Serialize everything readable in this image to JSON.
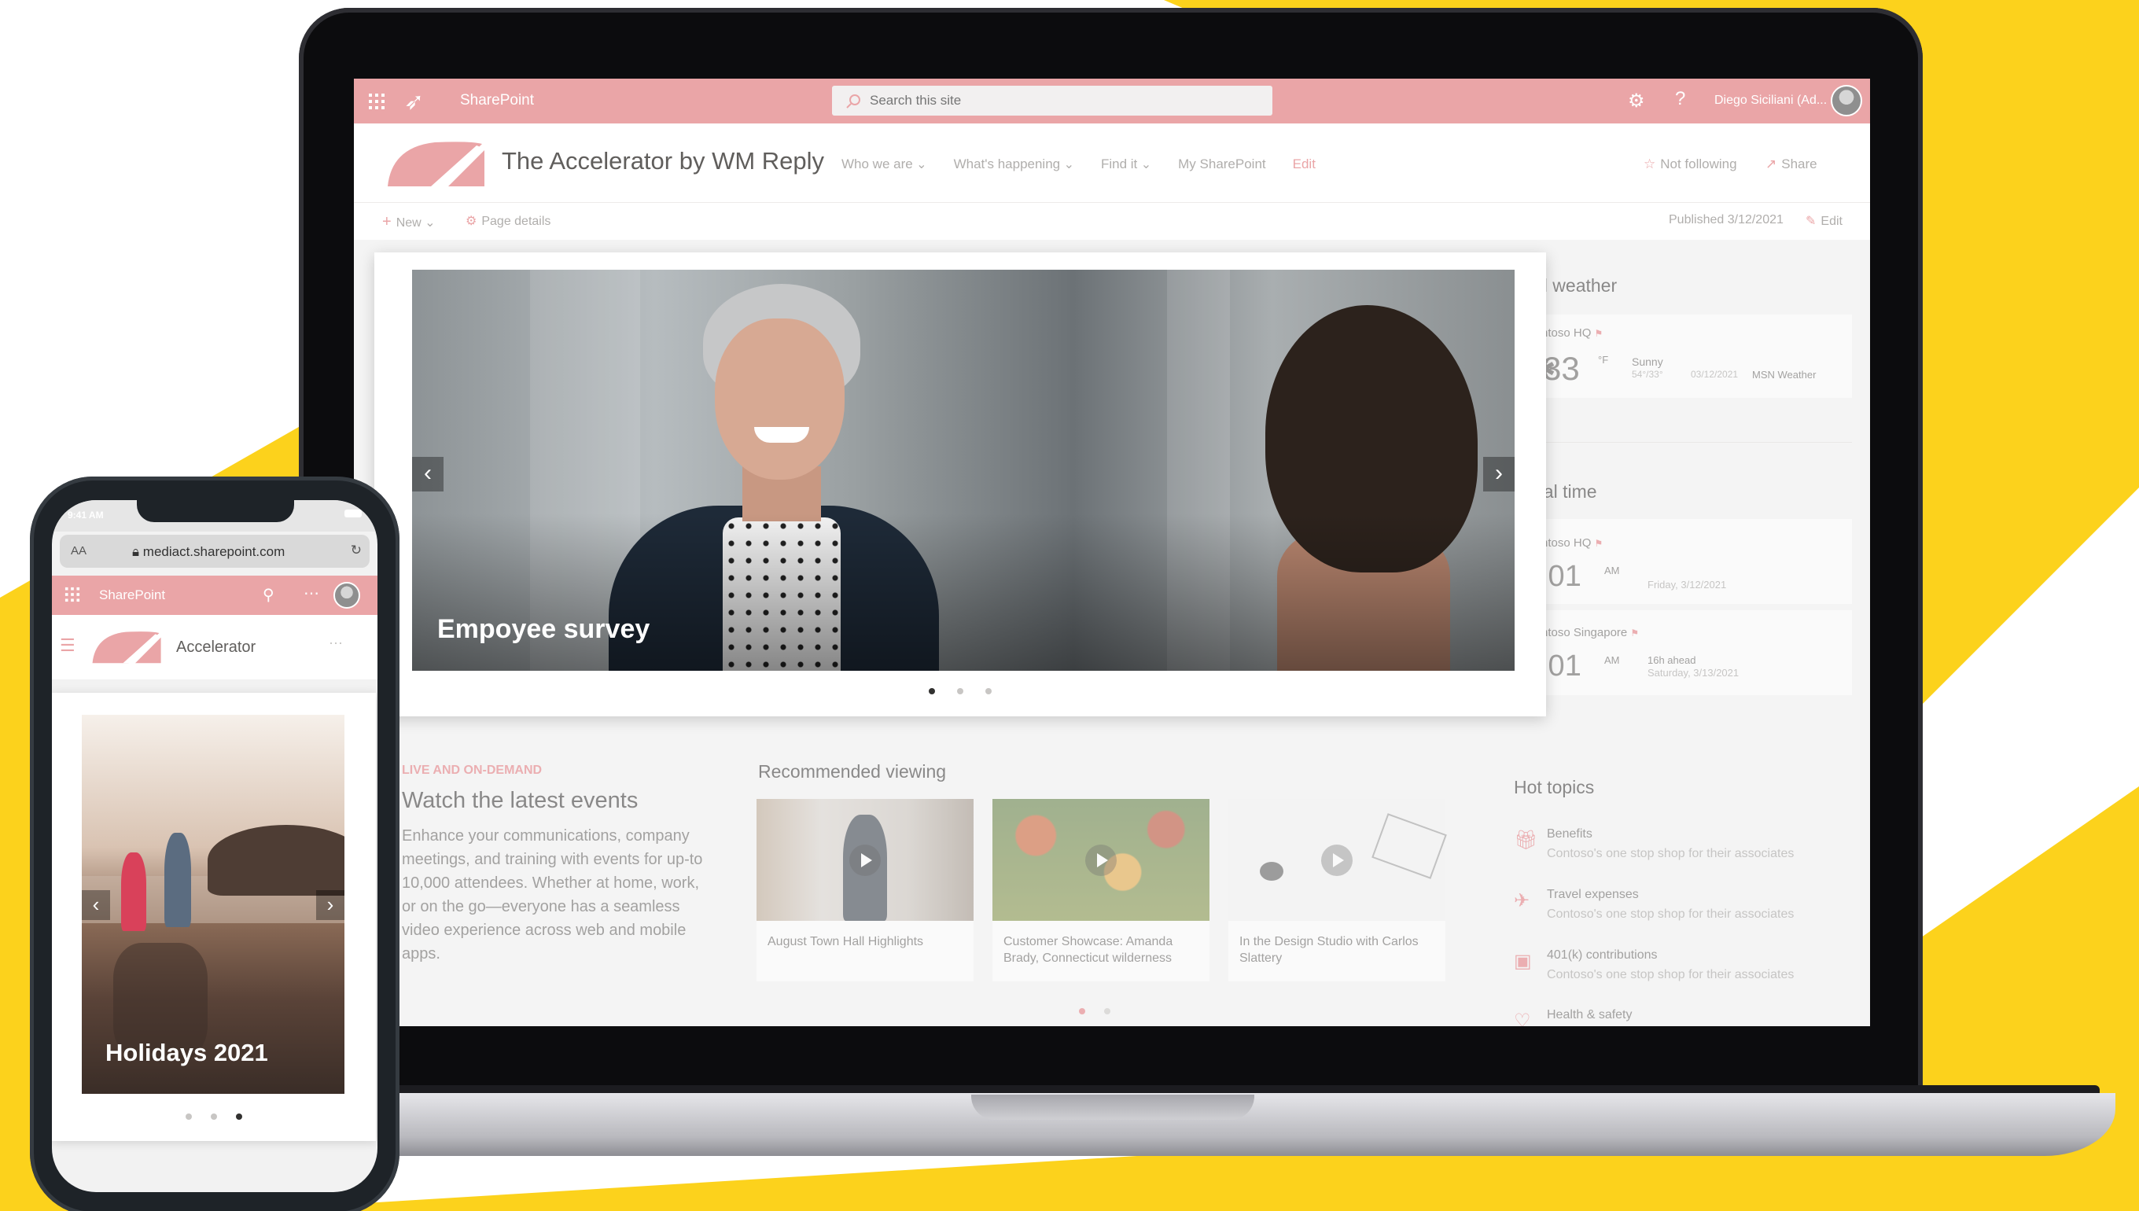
{
  "colors": {
    "accent": "#eaa5a7",
    "accent_text": "#e3767b",
    "yellow": "#fcd21c"
  },
  "suite": {
    "app_name": "SharePoint",
    "search_placeholder": "Search this site",
    "user_name": "Diego Siciliani (Ad..."
  },
  "site": {
    "title": "The Accelerator by WM Reply",
    "nav": [
      "Who we are",
      "What's happening",
      "Find it",
      "My SharePoint",
      "Edit"
    ],
    "follow": "Not following",
    "share": "Share"
  },
  "commandbar": {
    "new": "New",
    "page_details": "Page details",
    "published": "Published 3/12/2021",
    "edit": "Edit"
  },
  "hero": {
    "caption": "Empoyee survey",
    "active_slide": 1,
    "slide_count": 3
  },
  "events": {
    "label": "LIVE AND ON-DEMAND",
    "title": "Watch the latest events",
    "description": "Enhance your communications, company meetings, and training with events for up-to 10,000 attendees. Whether at home, work, or on the go—everyone has a seamless video experience across web and mobile apps."
  },
  "recommended": {
    "title": "Recommended viewing",
    "videos": [
      "August Town Hall Highlights",
      "Customer Showcase: Amanda Brady, Connecticut wilderness",
      "In the Design Studio with Carlos Slattery"
    ]
  },
  "weather": {
    "title": "al weather",
    "location": "ntoso HQ",
    "temperature": "33",
    "unit": "°F",
    "condition": "Sunny",
    "hilo": "54°/33°",
    "date": "03/12/2021",
    "source": "MSN Weather"
  },
  "world_clock": {
    "title": "bal time",
    "clocks": [
      {
        "location": "ntoso HQ",
        "time": ":01",
        "ampm": "AM",
        "ahead": "",
        "day": "Friday, 3/12/2021"
      },
      {
        "location": "ntoso Singapore",
        "time": ":01",
        "ampm": "AM",
        "ahead": "16h ahead",
        "day": "Saturday, 3/13/2021"
      }
    ]
  },
  "hot_topics": {
    "title": "Hot topics",
    "items": [
      {
        "name": "Benefits",
        "sub": "Contoso's one stop shop for their associates",
        "icon": "gift-icon"
      },
      {
        "name": "Travel expenses",
        "sub": "Contoso's one stop shop for their associates",
        "icon": "airplane-icon"
      },
      {
        "name": "401(k) contributions",
        "sub": "Contoso's one stop shop for their associates",
        "icon": "money-icon"
      },
      {
        "name": "Health & safety",
        "sub": "",
        "icon": "heart-icon"
      }
    ]
  },
  "phone": {
    "time": "9:41 AM",
    "aa": "AA",
    "url": "mediact.sharepoint.com",
    "app_name": "SharePoint",
    "site_name": "Accelerator",
    "hero_caption": "Holidays 2021",
    "active_slide": 3,
    "slide_count": 3
  }
}
